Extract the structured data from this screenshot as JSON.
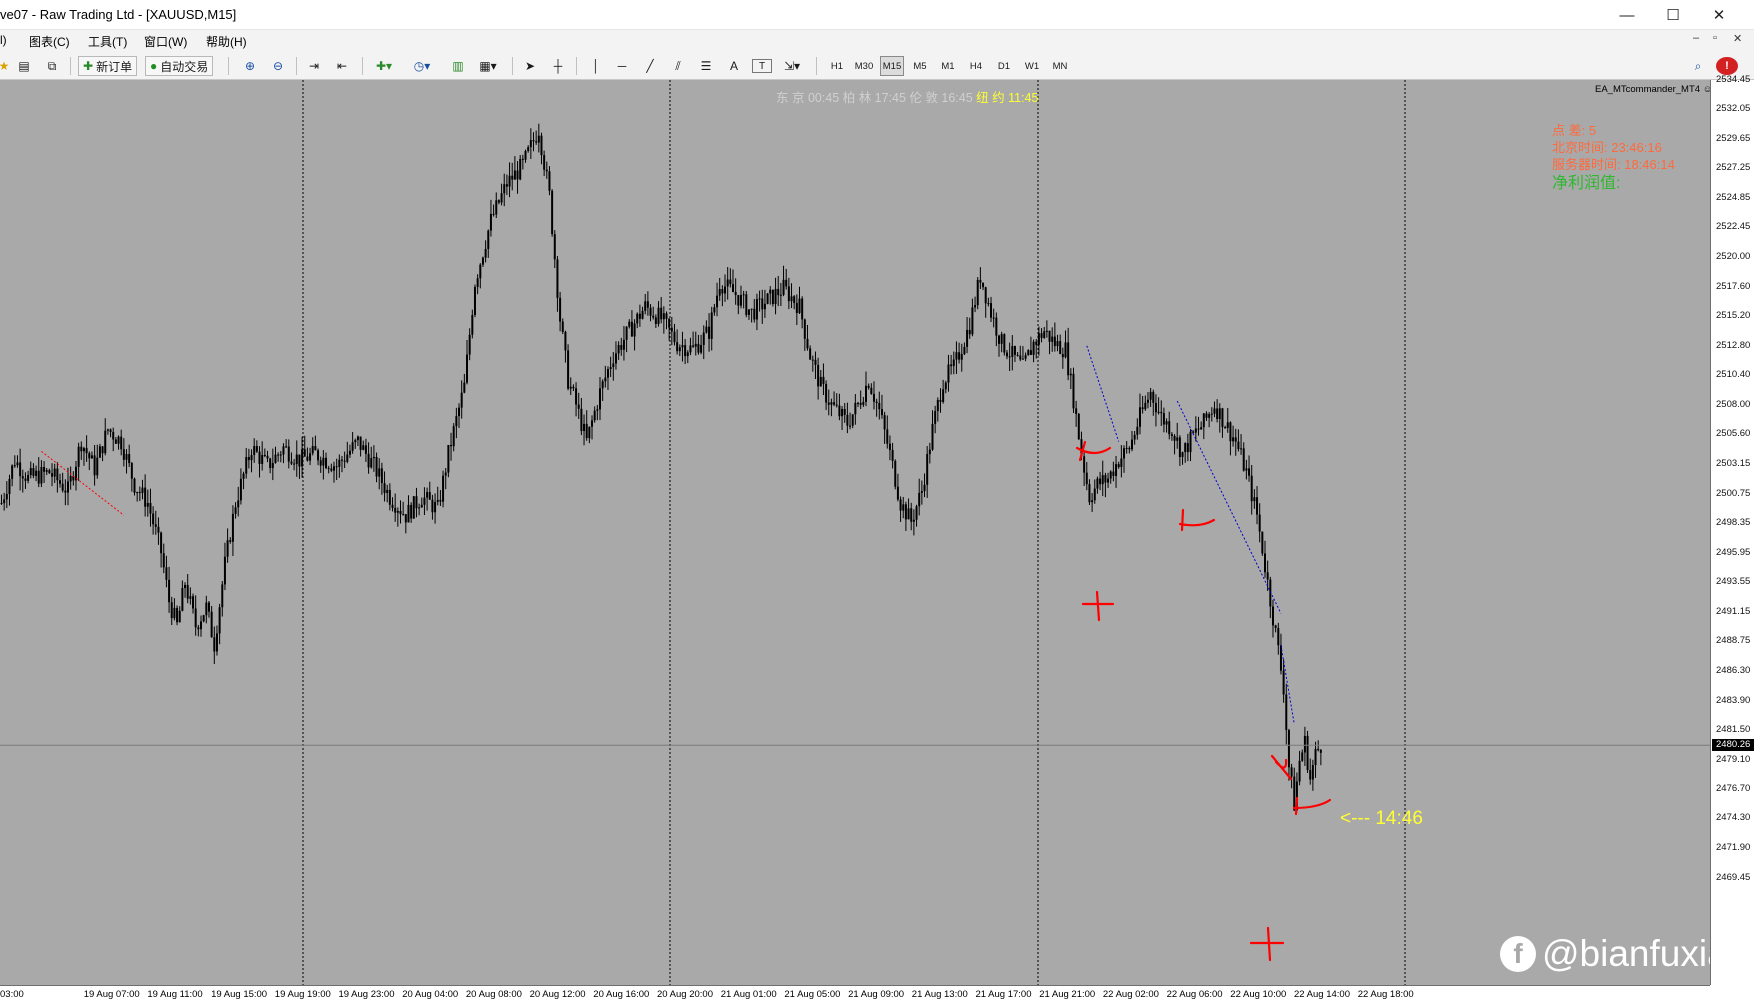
{
  "window": {
    "title": "ve07 - Raw Trading Ltd - [XAUUSD,M15]",
    "minimize": "—",
    "maximize": "☐",
    "close": "✕"
  },
  "menu": {
    "items": [
      "l)",
      "图表(C)",
      "工具(T)",
      "窗口(W)",
      "帮助(H)"
    ],
    "mdi_controls": [
      "–",
      "▫",
      "✕"
    ]
  },
  "toolbar": {
    "new_order": "新订单",
    "auto_trade": "自动交易",
    "timeframes": [
      "H1",
      "M30",
      "M15",
      "M5",
      "M1",
      "H4",
      "D1",
      "W1",
      "MN"
    ],
    "active_timeframe": "M15",
    "text_tool": "A",
    "label_tool": "T"
  },
  "chart": {
    "ea_label": "EA_MTcommander_MT4",
    "clock_tokyo": "东 京 00:45",
    "clock_berlin": "柏 林 17:45",
    "clock_london": "伦 敦 16:45",
    "clock_newyork": "纽 约 11:45",
    "info_line1": "点 差:      5",
    "info_line2": "北京时间:      23:46:16",
    "info_line3": "服务器时间:    18:46:14",
    "net_profit_label": "净利润值:",
    "time_arrow_label": "<--- 14:46",
    "watermark_handle": "@bianfuxia",
    "watermark_logo": "f",
    "current_price": "2480.26",
    "colors": {
      "background": "#a9a9a9",
      "candles": "#000000",
      "trend_dots": "#0000cc",
      "marks": "#ff0000",
      "clock_ny": "#ffff33",
      "info_red": "#ff6a3c",
      "info_green": "#2fb82f"
    }
  },
  "chart_data": {
    "type": "candlestick",
    "symbol": "XAUUSD",
    "timeframe": "M15",
    "price_labels": [
      "2534.45",
      "2532.05",
      "2529.65",
      "2527.25",
      "2524.85",
      "2522.45",
      "2520.00",
      "2517.60",
      "2515.20",
      "2512.80",
      "2510.40",
      "2508.00",
      "2505.60",
      "2503.15",
      "2500.75",
      "2498.35",
      "2495.95",
      "2493.55",
      "2491.15",
      "2488.75",
      "2486.30",
      "2483.90",
      "2481.50",
      "2479.10",
      "2476.70",
      "2474.30",
      "2471.90",
      "2469.45"
    ],
    "ylim": [
      2469.45,
      2534.45
    ],
    "time_labels": [
      "03:00",
      "19 Aug 07:00",
      "19 Aug 11:00",
      "19 Aug 15:00",
      "19 Aug 19:00",
      "19 Aug 23:00",
      "20 Aug 04:00",
      "20 Aug 08:00",
      "20 Aug 12:00",
      "20 Aug 16:00",
      "20 Aug 20:00",
      "21 Aug 01:00",
      "21 Aug 05:00",
      "21 Aug 09:00",
      "21 Aug 13:00",
      "21 Aug 17:00",
      "21 Aug 21:00",
      "22 Aug 02:00",
      "22 Aug 06:00",
      "22 Aug 10:00",
      "22 Aug 14:00",
      "22 Aug 18:00"
    ],
    "close_path": [
      [
        0,
        2500.0
      ],
      [
        5,
        2503.5
      ],
      [
        10,
        2502.0
      ],
      [
        18,
        2502.5
      ],
      [
        25,
        2501.0
      ],
      [
        30,
        2505.0
      ],
      [
        35,
        2502.8
      ],
      [
        40,
        2506.0
      ],
      [
        45,
        2505.0
      ],
      [
        50,
        2501.5
      ],
      [
        55,
        2500.0
      ],
      [
        60,
        2496.0
      ],
      [
        63,
        2492.0
      ],
      [
        66,
        2490.0
      ],
      [
        69,
        2493.5
      ],
      [
        73,
        2490.0
      ],
      [
        77,
        2491.5
      ],
      [
        80,
        2488.5
      ],
      [
        84,
        2495.0
      ],
      [
        88,
        2500.0
      ],
      [
        94,
        2504.5
      ],
      [
        100,
        2503.0
      ],
      [
        106,
        2504.5
      ],
      [
        112,
        2503.5
      ],
      [
        118,
        2504.0
      ],
      [
        126,
        2503.0
      ],
      [
        134,
        2505.0
      ],
      [
        140,
        2503.0
      ],
      [
        146,
        2500.5
      ],
      [
        152,
        2499.0
      ],
      [
        158,
        2500.5
      ],
      [
        164,
        2499.5
      ],
      [
        168,
        2504.0
      ],
      [
        174,
        2509.5
      ],
      [
        178,
        2518.0
      ],
      [
        184,
        2523.0
      ],
      [
        190,
        2526.0
      ],
      [
        196,
        2527.5
      ],
      [
        202,
        2530.5
      ],
      [
        206,
        2525.0
      ],
      [
        210,
        2515.0
      ],
      [
        213,
        2510.0
      ],
      [
        216,
        2508.0
      ],
      [
        220,
        2505.0
      ],
      [
        225,
        2509.0
      ],
      [
        230,
        2512.0
      ],
      [
        236,
        2514.0
      ],
      [
        242,
        2516.0
      ],
      [
        248,
        2515.0
      ],
      [
        254,
        2513.0
      ],
      [
        260,
        2512.5
      ],
      [
        266,
        2514.0
      ],
      [
        270,
        2518.0
      ],
      [
        276,
        2517.0
      ],
      [
        282,
        2515.5
      ],
      [
        288,
        2516.5
      ],
      [
        294,
        2517.5
      ],
      [
        300,
        2516.0
      ],
      [
        304,
        2512.0
      ],
      [
        308,
        2509.5
      ],
      [
        312,
        2508.0
      ],
      [
        318,
        2506.5
      ],
      [
        322,
        2508.0
      ],
      [
        326,
        2510.0
      ],
      [
        330,
        2507.5
      ],
      [
        334,
        2504.0
      ],
      [
        338,
        2500.0
      ],
      [
        342,
        2498.5
      ],
      [
        346,
        2501.0
      ],
      [
        350,
        2506.0
      ],
      [
        354,
        2510.0
      ],
      [
        358,
        2511.0
      ],
      [
        364,
        2514.5
      ],
      [
        368,
        2518.5
      ],
      [
        372,
        2515.5
      ],
      [
        376,
        2513.0
      ],
      [
        380,
        2512.0
      ],
      [
        384,
        2511.0
      ],
      [
        388,
        2513.0
      ],
      [
        392,
        2514.0
      ],
      [
        396,
        2513.0
      ],
      [
        400,
        2512.5
      ],
      [
        403,
        2508.5
      ],
      [
        406,
        2504.0
      ],
      [
        409,
        2500.5
      ],
      [
        412,
        2501.5
      ],
      [
        416,
        2502.0
      ],
      [
        420,
        2503.5
      ],
      [
        424,
        2504.5
      ],
      [
        428,
        2507.0
      ],
      [
        432,
        2509.0
      ],
      [
        436,
        2507.0
      ],
      [
        440,
        2506.0
      ],
      [
        444,
        2504.0
      ],
      [
        448,
        2505.5
      ],
      [
        452,
        2506.5
      ],
      [
        456,
        2508.0
      ],
      [
        460,
        2506.5
      ],
      [
        464,
        2505.0
      ],
      [
        468,
        2502.5
      ],
      [
        472,
        2499.0
      ],
      [
        476,
        2493.5
      ],
      [
        480,
        2488.0
      ],
      [
        482,
        2485.0
      ],
      [
        484,
        2478.5
      ],
      [
        486,
        2475.5
      ],
      [
        488,
        2479.0
      ],
      [
        490,
        2480.5
      ],
      [
        492,
        2477.5
      ],
      [
        494,
        2479.5
      ],
      [
        496,
        2480.3
      ]
    ],
    "trend_lines": [
      {
        "from": [
          15,
          2504.2
        ],
        "to": [
          46,
          2499.0
        ],
        "color": "red"
      },
      {
        "from": [
          408,
          2512.8
        ],
        "to": [
          420,
          2505.0
        ],
        "color": "blue"
      },
      {
        "from": [
          442,
          2508.3
        ],
        "to": [
          481,
          2491.0
        ],
        "color": "blue"
      },
      {
        "from": [
          481,
          2488.4
        ],
        "to": [
          486,
          2482.0
        ],
        "color": "blue"
      }
    ],
    "horizontal_line": 2480.26,
    "bars_visible": 500
  }
}
